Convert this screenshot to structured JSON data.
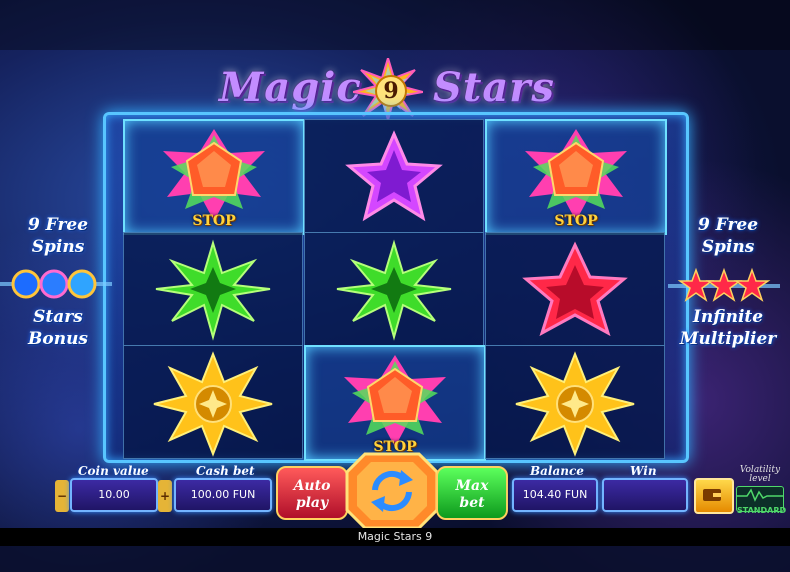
{
  "game": {
    "title_left": "Magic",
    "title_number": "9",
    "title_right": "Stars",
    "footer_title": "Magic Stars 9"
  },
  "reels": {
    "rows": [
      [
        {
          "symbol": "red-gem-star",
          "highlight": true,
          "label": "STOP"
        },
        {
          "symbol": "purple-star",
          "highlight": false,
          "label": ""
        },
        {
          "symbol": "red-gem-star",
          "highlight": true,
          "label": "STOP"
        }
      ],
      [
        {
          "symbol": "green-star",
          "highlight": false,
          "label": ""
        },
        {
          "symbol": "green-star",
          "highlight": false,
          "label": ""
        },
        {
          "symbol": "red-star",
          "highlight": false,
          "label": ""
        }
      ],
      [
        {
          "symbol": "gold-star",
          "highlight": false,
          "label": ""
        },
        {
          "symbol": "red-gem-star",
          "highlight": true,
          "label": "STOP"
        },
        {
          "symbol": "gold-star",
          "highlight": false,
          "label": ""
        }
      ]
    ]
  },
  "left_panel": {
    "line1": "9 Free",
    "line2": "Spins",
    "line3": "Stars",
    "line4": "Bonus"
  },
  "right_panel": {
    "line1": "9 Free",
    "line2": "Spins",
    "line3": "Infinite",
    "line4": "Multiplier"
  },
  "controls": {
    "coin_value_label": "Coin value",
    "coin_value": "10.00",
    "decrease": "−",
    "increase": "+",
    "cash_bet_label": "Cash bet",
    "cash_bet": "100.00 FUN",
    "auto_play_line1": "Auto",
    "auto_play_line2": "play",
    "max_bet_line1": "Max",
    "max_bet_line2": "bet",
    "balance_label": "Balance",
    "balance": "104.40 FUN",
    "win_label": "Win",
    "win": "",
    "volatility_label_1": "Volatility",
    "volatility_label_2": "level",
    "volatility_value": "STANDARD"
  },
  "icons": {
    "spin": "refresh-arrows-icon",
    "menu": "wallet-icon"
  },
  "colors": {
    "frame": "#58c6ff",
    "stop_label": "#ffd23c",
    "auto_play": "#e0213a",
    "max_bet": "#1bbf2b",
    "spin_center": "#2b8cff"
  }
}
